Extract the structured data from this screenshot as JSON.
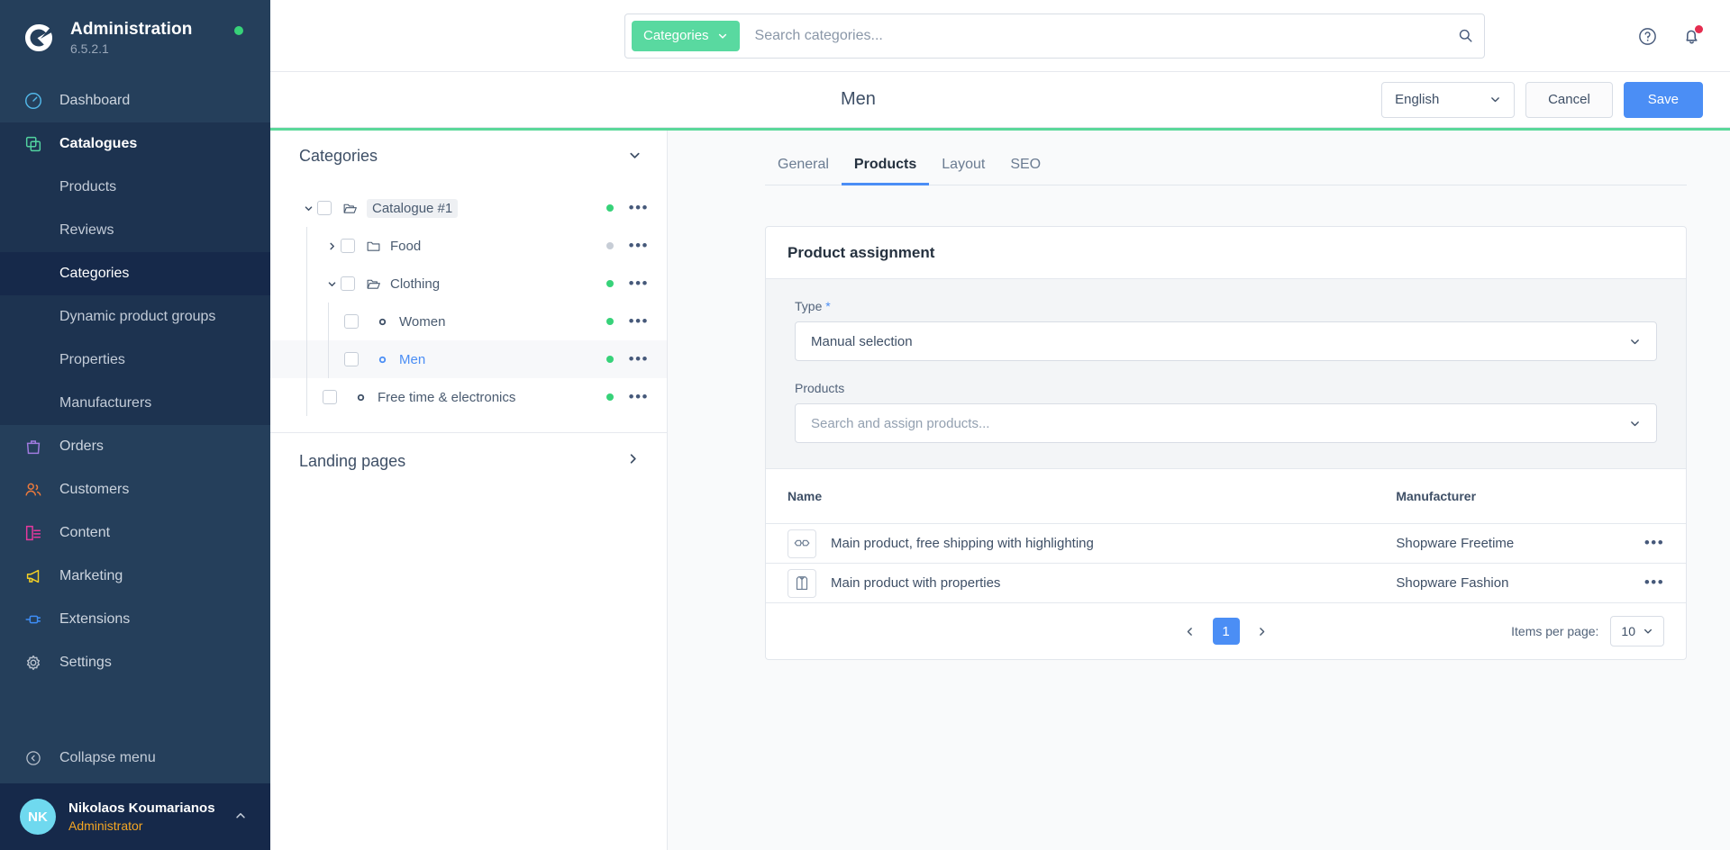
{
  "sidebar": {
    "brand": {
      "title": "Administration",
      "version": "6.5.2.1"
    },
    "items": [
      {
        "label": "Dashboard",
        "icon": "gauge-icon"
      },
      {
        "label": "Catalogues",
        "icon": "catalogues-icon"
      },
      {
        "label": "Products"
      },
      {
        "label": "Reviews"
      },
      {
        "label": "Categories"
      },
      {
        "label": "Dynamic product groups"
      },
      {
        "label": "Properties"
      },
      {
        "label": "Manufacturers"
      },
      {
        "label": "Orders",
        "icon": "bag-icon"
      },
      {
        "label": "Customers",
        "icon": "users-icon"
      },
      {
        "label": "Content",
        "icon": "content-icon"
      },
      {
        "label": "Marketing",
        "icon": "megaphone-icon"
      },
      {
        "label": "Extensions",
        "icon": "plug-icon"
      },
      {
        "label": "Settings",
        "icon": "gear-icon"
      }
    ],
    "collapse_label": "Collapse menu",
    "user": {
      "initials": "NK",
      "name": "Nikolaos Koumarianos",
      "role": "Administrator"
    }
  },
  "topbar": {
    "search_scope": "Categories",
    "search_placeholder": "Search categories..."
  },
  "pagehead": {
    "title": "Men",
    "language": "English",
    "cancel_label": "Cancel",
    "save_label": "Save"
  },
  "tree": {
    "section_title": "Categories",
    "landing_title": "Landing pages",
    "nodes": [
      {
        "label": "Catalogue #1",
        "depth": 0,
        "type": "folder-open",
        "expanded": true,
        "active_dot": true,
        "chip": true
      },
      {
        "label": "Food",
        "depth": 1,
        "type": "folder-closed",
        "expanded": false,
        "active_dot": false
      },
      {
        "label": "Clothing",
        "depth": 1,
        "type": "folder-open",
        "expanded": true,
        "active_dot": true
      },
      {
        "label": "Women",
        "depth": 2,
        "type": "leaf",
        "active_dot": true
      },
      {
        "label": "Men",
        "depth": 2,
        "type": "leaf",
        "active_dot": true,
        "selected": true
      },
      {
        "label": "Free time & electronics",
        "depth": 1,
        "type": "leaf",
        "active_dot": true
      }
    ]
  },
  "detail": {
    "tabs": [
      {
        "label": "General",
        "active": false
      },
      {
        "label": "Products",
        "active": true
      },
      {
        "label": "Layout",
        "active": false
      },
      {
        "label": "SEO",
        "active": false
      }
    ],
    "card_title": "Product assignment",
    "type_label": "Type",
    "type_value": "Manual selection",
    "products_label": "Products",
    "products_placeholder": "Search and assign products...",
    "table": {
      "columns": [
        "Name",
        "Manufacturer"
      ],
      "rows": [
        {
          "name": "Main product, free shipping with highlighting",
          "manufacturer": "Shopware Freetime",
          "thumb": "glasses-icon"
        },
        {
          "name": "Main product with properties",
          "manufacturer": "Shopware Fashion",
          "thumb": "jacket-icon"
        }
      ]
    },
    "pagination": {
      "page": "1",
      "items_per_page_label": "Items per page:",
      "items_per_page": "10"
    }
  },
  "colors": {
    "sidebar_bg": "#253f5b",
    "accent_green": "#5bd89a",
    "primary_blue": "#4b8ef5",
    "status_green": "#37d279",
    "role_orange": "#f5a623",
    "notification_red": "#e52d50"
  }
}
